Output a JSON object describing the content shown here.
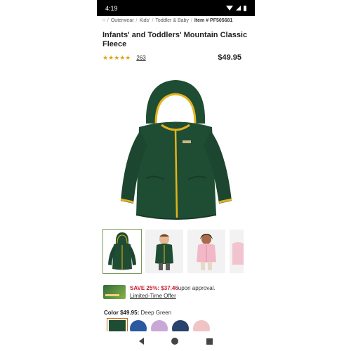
{
  "status_bar": {
    "time": "4:19"
  },
  "breadcrumb": {
    "items": [
      "n",
      "Outerwear",
      "Kids'",
      "Toddler & Baby"
    ],
    "item_number": "Item # PF505681"
  },
  "product": {
    "title": "Infants' and Toddlers' Mountain Classic Fleece",
    "rating": 4.5,
    "rating_stars": "★★★★★",
    "review_count": "263",
    "price": "$49.95"
  },
  "gallery": {
    "thumbnails": [
      "fleece-jacket-front",
      "toddler-boy-green-fleece",
      "toddler-girl-pink-fleece",
      "partial-pink-fleece"
    ]
  },
  "promo": {
    "save_text": "SAVE 25%: $37.46",
    "rest_text": "upon approval.",
    "link_text": "Limited-Time Offer"
  },
  "color": {
    "label": "Color $49.95:",
    "name": "Deep Green",
    "swatches": [
      "#1f4d33",
      "#2a5aa0",
      "#c9a8d8",
      "#27426b",
      "#f0c4c4"
    ]
  },
  "colors": {
    "fleece": "#1f4d33",
    "trim": "#e3b21c",
    "accent_red": "#c81e2d",
    "star": "#e1a51a"
  }
}
